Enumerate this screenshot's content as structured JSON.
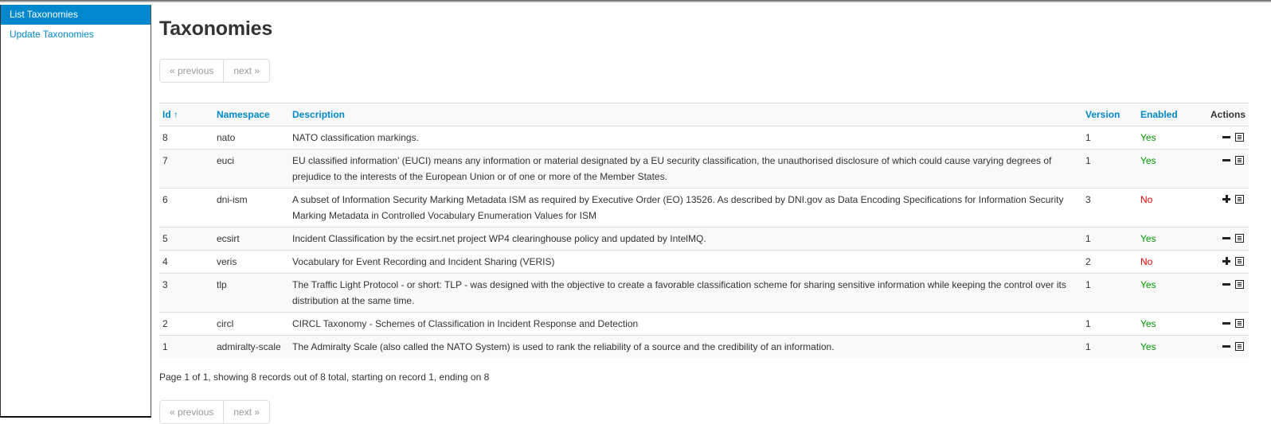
{
  "sidebar": {
    "items": [
      {
        "label": "List Taxonomies",
        "active": true
      },
      {
        "label": "Update Taxonomies",
        "active": false
      }
    ]
  },
  "page": {
    "title": "Taxonomies",
    "pager": {
      "previous": "« previous",
      "next": "next »"
    },
    "status": "Page 1 of 1, showing 8 records out of 8 total, starting on record 1, ending on 8"
  },
  "table": {
    "headers": {
      "id": "Id ↑",
      "namespace": "Namespace",
      "description": "Description",
      "version": "Version",
      "enabled": "Enabled",
      "actions": "Actions"
    },
    "rows": [
      {
        "id": "8",
        "namespace": "nato",
        "description": "NATO classification markings.",
        "version": "1",
        "enabled": "Yes",
        "action": "disable"
      },
      {
        "id": "7",
        "namespace": "euci",
        "description": "EU classified information’ (EUCI) means any information or material designated by a EU security classification, the unauthorised disclosure of which could cause varying degrees of prejudice to the interests of the European Union or of one or more of the Member States.",
        "version": "1",
        "enabled": "Yes",
        "action": "disable"
      },
      {
        "id": "6",
        "namespace": "dni-ism",
        "description": "A subset of Information Security Marking Metadata ISM as required by Executive Order (EO) 13526. As described by DNI.gov as Data Encoding Specifications for Information Security Marking Metadata in Controlled Vocabulary Enumeration Values for ISM",
        "version": "3",
        "enabled": "No",
        "action": "enable"
      },
      {
        "id": "5",
        "namespace": "ecsirt",
        "description": "Incident Classification by the ecsirt.net project WP4 clearinghouse policy and updated by IntelMQ.",
        "version": "1",
        "enabled": "Yes",
        "action": "disable"
      },
      {
        "id": "4",
        "namespace": "veris",
        "description": "Vocabulary for Event Recording and Incident Sharing (VERIS)",
        "version": "2",
        "enabled": "No",
        "action": "enable"
      },
      {
        "id": "3",
        "namespace": "tlp",
        "description": "The Traffic Light Protocol - or short: TLP - was designed with the objective to create a favorable classification scheme for sharing sensitive information while keeping the control over its distribution at the same time.",
        "version": "1",
        "enabled": "Yes",
        "action": "disable"
      },
      {
        "id": "2",
        "namespace": "circl",
        "description": "CIRCL Taxonomy - Schemes of Classification in Incident Response and Detection",
        "version": "1",
        "enabled": "Yes",
        "action": "disable"
      },
      {
        "id": "1",
        "namespace": "admiralty-scale",
        "description": "The Admiralty Scale (also called the NATO System) is used to rank the reliability of a source and the credibility of an information.",
        "version": "1",
        "enabled": "Yes",
        "action": "disable"
      }
    ]
  },
  "colors": {
    "accent": "#0088cc",
    "yes": "#009900",
    "no": "#ee0000"
  }
}
